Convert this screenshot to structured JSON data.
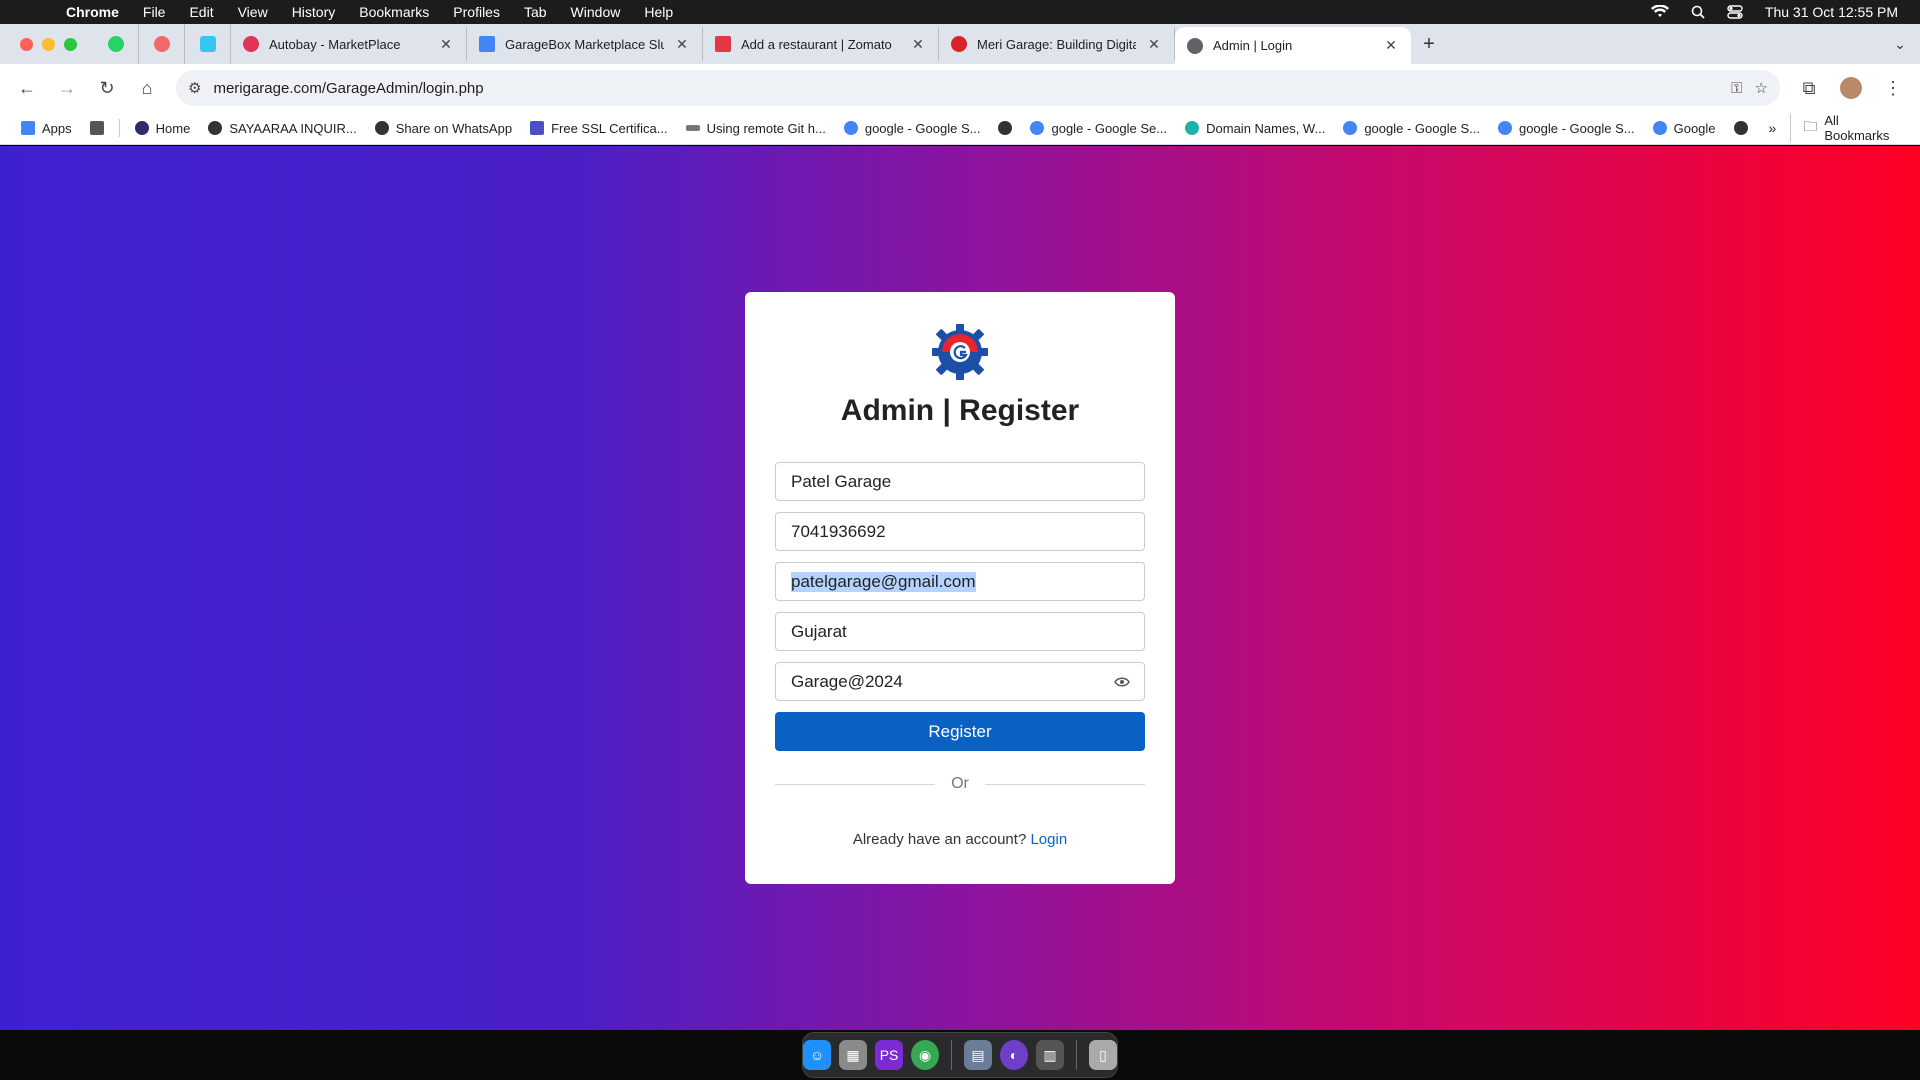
{
  "menubar": {
    "app": "Chrome",
    "items": [
      "File",
      "Edit",
      "View",
      "History",
      "Bookmarks",
      "Profiles",
      "Tab",
      "Window",
      "Help"
    ],
    "clock": "Thu 31 Oct  12:55 PM"
  },
  "tabs": [
    {
      "title": "Autobay - MarketPlace",
      "favicon_color": "#e4335a"
    },
    {
      "title": "GarageBox Marketplace Slug",
      "favicon_color": "#4285f4"
    },
    {
      "title": "Add a restaurant | Zomato",
      "favicon_color": "#e23744"
    },
    {
      "title": "Meri Garage: Building Digital",
      "favicon_color": "#d8232a"
    },
    {
      "title": "Admin | Login",
      "favicon_color": "#5f6368",
      "active": true
    }
  ],
  "pinned_tabs": [
    {
      "icon": "whatsapp-icon",
      "color": "#25d366"
    },
    {
      "icon": "asana-icon",
      "color": "#f06a6a"
    },
    {
      "icon": "slack-icon",
      "color": "#36c5f0"
    }
  ],
  "address_bar": {
    "url": "merigarage.com/GarageAdmin/login.php"
  },
  "bookmarks": [
    {
      "label": "Apps",
      "color": "#4285f4"
    },
    {
      "label": "",
      "color": "#555"
    },
    {
      "label": "Home",
      "color": "#2d2d6a"
    },
    {
      "label": "SAYAARAA INQUIR...",
      "color": "#333"
    },
    {
      "label": "Share on WhatsApp",
      "color": "#333"
    },
    {
      "label": "Free SSL Certifica...",
      "color": "#4b4fc7"
    },
    {
      "label": "Using remote Git h...",
      "color": "#777"
    },
    {
      "label": "google - Google S...",
      "color": "#4285f4"
    },
    {
      "label": "",
      "color": "#333"
    },
    {
      "label": "gogle - Google Se...",
      "color": "#4285f4"
    },
    {
      "label": "Domain Names, W...",
      "color": "#1bb3a5"
    },
    {
      "label": "google - Google S...",
      "color": "#4285f4"
    },
    {
      "label": "google - Google S...",
      "color": "#4285f4"
    },
    {
      "label": "Google",
      "color": "#4285f4"
    },
    {
      "label": "",
      "color": "#333"
    }
  ],
  "bookmarks_more": "»",
  "bookmarks_all": "All Bookmarks",
  "form": {
    "title": "Admin | Register",
    "garage_name": "Patel Garage",
    "phone": "7041936692",
    "email": "patelgarage@gmail.com",
    "state": "Gujarat",
    "password": "Garage@2024",
    "register_label": "Register",
    "divider_text": "Or",
    "login_prompt": "Already have an account?",
    "login_link": "Login"
  },
  "colors": {
    "primary": "#0a61c4",
    "gradient_start": "#3f20d0",
    "gradient_end": "#ff0024"
  },
  "dock_apps": [
    {
      "name": "finder-icon",
      "color": "#1e90ff"
    },
    {
      "name": "launchpad-icon",
      "color": "#8a8a8a"
    },
    {
      "name": "phpstorm-icon",
      "color": "#7a2bd4"
    },
    {
      "name": "chrome-icon",
      "color": "#34a853"
    },
    {
      "name": "preview-icon",
      "color": "#6a7d99"
    },
    {
      "name": "github-desktop-icon",
      "color": "#6e40c9"
    },
    {
      "name": "calculator-icon",
      "color": "#555"
    },
    {
      "name": "trash-icon",
      "color": "#aaa"
    }
  ]
}
